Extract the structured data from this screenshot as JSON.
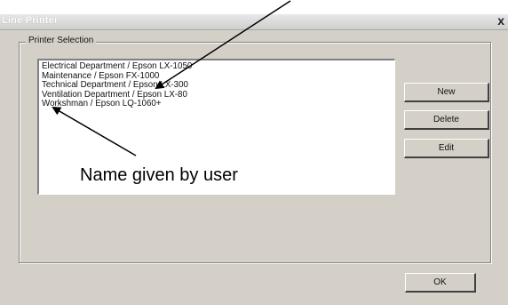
{
  "window": {
    "title": "Line Printer",
    "close_label": "x"
  },
  "group": {
    "label": "Printer Selection"
  },
  "printers": [
    "Electrical Department / Epson LX-1050",
    "Maintenance / Epson FX-1000",
    "Technical Department / Epson LX-300",
    "Ventilation Department / Epson LX-80",
    "Workshman / Epson LQ-1060+"
  ],
  "buttons": {
    "new": "New",
    "delete": "Delete",
    "edit": "Edit",
    "ok": "OK"
  },
  "annotation": {
    "text": "Name given by user"
  }
}
